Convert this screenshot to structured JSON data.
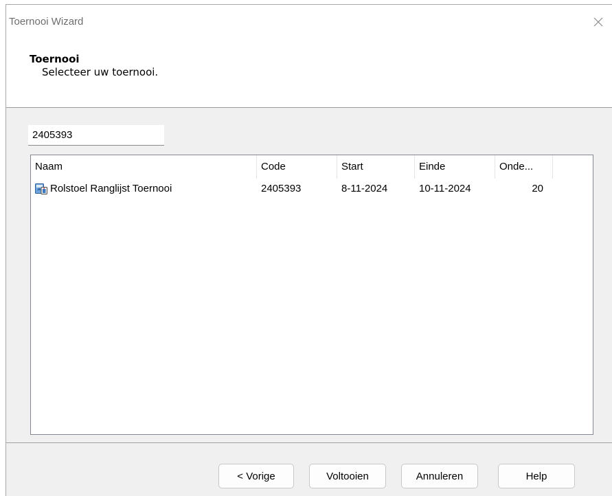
{
  "window": {
    "title": "Toernooi Wizard"
  },
  "header": {
    "title": "Toernooi",
    "subtitle": "Selecteer uw toernooi."
  },
  "search": {
    "value": "2405393"
  },
  "table": {
    "columns": [
      "Naam",
      "Code",
      "Start",
      "Einde",
      "Onde..."
    ],
    "rows": [
      {
        "icon": "tournament-icon",
        "naam": "Rolstoel Ranglijst Toernooi",
        "code": "2405393",
        "start": "8-11-2024",
        "einde": "10-11-2024",
        "onde": "20"
      }
    ]
  },
  "buttons": {
    "back": "< Vorige",
    "finish": "Voltooien",
    "cancel": "Annuleren",
    "help": "Help"
  },
  "icons": {
    "close": "close-icon"
  }
}
